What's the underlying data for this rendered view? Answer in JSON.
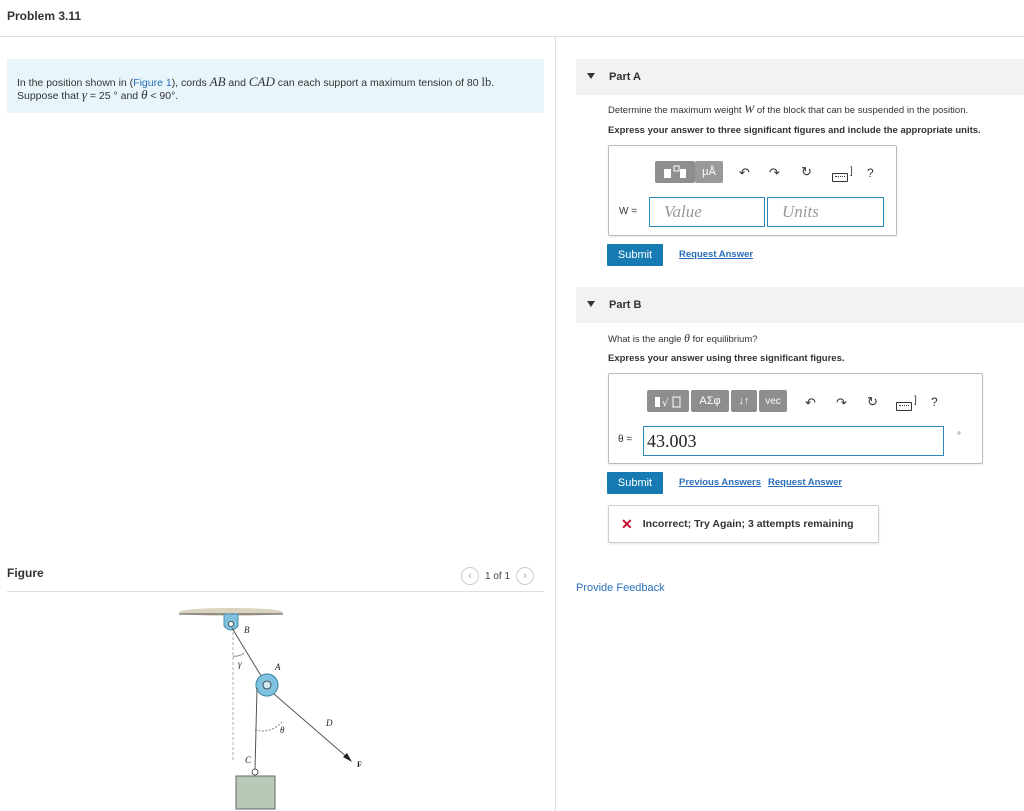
{
  "header": {
    "title": "Problem 3.11"
  },
  "problem": {
    "line1_pre": "In the position shown in (",
    "figure_link": "Figure 1",
    "line1_mid1": "), cords ",
    "cord1": "AB",
    "line1_mid2": " and ",
    "cord2": "CAD",
    "line1_mid3": " can each support a maximum tension of 80 ",
    "unit": "lb",
    "line1_end": ".",
    "line2_pre": "Suppose that ",
    "gamma": "γ",
    "line2_mid": " = 25 ° and ",
    "theta": "θ",
    "line2_end": " < 90°."
  },
  "figure": {
    "label": "Figure",
    "pager": "1 of 1",
    "prev_icon": "chevron-left-icon",
    "next_icon": "chevron-right-icon",
    "labels": {
      "B": "B",
      "A": "A",
      "C": "C",
      "D": "D",
      "F": "F",
      "gamma": "γ",
      "theta": "θ"
    }
  },
  "partA": {
    "label": "Part A",
    "question_pre": "Determine the maximum weight ",
    "question_var": "W",
    "question_post": " of the block that can be suspended in the position.",
    "instruction": "Express your answer to three significant figures and include the appropriate units.",
    "toolbar": {
      "templates_icon": "templates-icon",
      "units_btn": "μÅ",
      "undo_icon": "undo-icon",
      "redo_icon": "redo-icon",
      "reset_icon": "reset-icon",
      "keyboard_icon": "keyboard-icon",
      "help": "?"
    },
    "field_label": "W =",
    "value_placeholder": "Value",
    "units_placeholder": "Units",
    "submit": "Submit",
    "request_answer": "Request Answer"
  },
  "partB": {
    "label": "Part B",
    "question_pre": "What is the angle ",
    "question_var": "θ",
    "question_post": " for equilibrium?",
    "instruction": "Express your answer using three significant figures.",
    "toolbar": {
      "templates_icon": "templates-icon",
      "greek_btn": "ΑΣφ",
      "arrows_btn": "↓↑",
      "vec_btn": "vec",
      "undo_icon": "undo-icon",
      "redo_icon": "redo-icon",
      "reset_icon": "reset-icon",
      "keyboard_icon": "keyboard-icon",
      "help": "?"
    },
    "field_label": "θ =",
    "value": "43.003",
    "unit_mark": "°",
    "submit": "Submit",
    "previous_answers": "Previous Answers",
    "request_answer": "Request Answer",
    "feedback": "Incorrect; Try Again; 3 attempts remaining"
  },
  "footer": {
    "provide_feedback": "Provide Feedback"
  },
  "colors": {
    "accent": "#167ab3",
    "link": "#2a6ebb",
    "error": "#c8102e",
    "problem_bg": "#e8f5fa"
  }
}
